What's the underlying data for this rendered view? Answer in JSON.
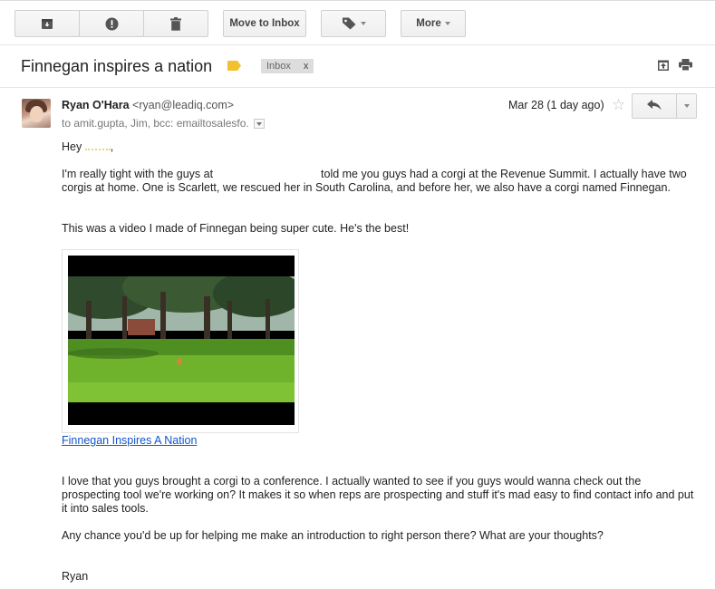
{
  "toolbar": {
    "archive_icon": "archive-icon",
    "spam_icon": "report-spam-icon",
    "delete_icon": "trash-icon",
    "move_to_inbox_label": "Move to Inbox",
    "labels_icon": "label-tag-icon",
    "more_label": "More"
  },
  "thread": {
    "subject": "Finnegan inspires a nation",
    "importance_color": "#f2c12e",
    "inbox_tag": "Inbox",
    "inbox_tag_close": "x"
  },
  "message": {
    "sender_name": "Ryan O'Hara",
    "sender_email": "<ryan@leadiq.com>",
    "recipients": "to amit.gupta, Jim, bcc: emailtosalesfo.",
    "date": "Mar 28 (1 day ago)",
    "star": "☆",
    "greeting": "Hey",
    "greeting_end": ",",
    "para1_start": "I'm really tight with the guys at",
    "para1_rest": "told me you guys had a corgi at the Revenue Summit. I actually have two corgis at home. One is Scarlett, we rescued her in South Carolina, and before her, we also have a corgi named Finnegan.",
    "para2": "This was a video I made of Finnegan being super cute. He's the best!",
    "video_link": "Finnegan Inspires A Nation",
    "para3": "I love that you guys brought a corgi to a conference. I actually wanted to see if you guys would wanna check out the prospecting tool we're working on? It makes it so when reps are prospecting and stuff it's mad easy to find contact info and put it into sales tools.",
    "para4": "Any chance you'd be up for helping me make an introduction to right person there? What are your thoughts?",
    "signature": "Ryan"
  }
}
